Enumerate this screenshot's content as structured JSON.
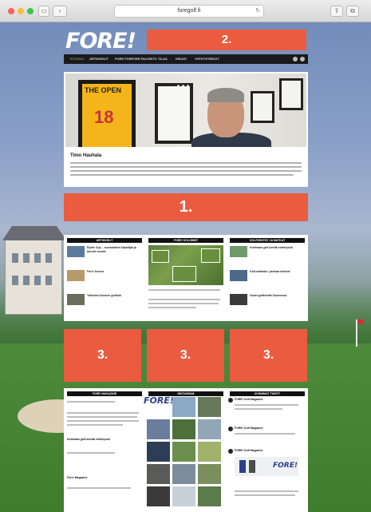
{
  "browser": {
    "address": "foregolf.fi"
  },
  "site": {
    "logo": "FORE!",
    "nav": [
      {
        "label": "ETUSIVU",
        "active": true
      },
      {
        "label": "ARTIKKELIT",
        "active": false
      },
      {
        "label": "FORE FOREVER PALKINTO",
        "active": false
      },
      {
        "label": "TILAA",
        "active": false
      },
      {
        "label": "KIRJAT",
        "active": false
      },
      {
        "label": "YHTEYSTIEDOT",
        "active": false
      }
    ]
  },
  "hero": {
    "frame_number": "18",
    "frame_text": "THE OPEN",
    "headline": "Timo Hauhala"
  },
  "callouts": {
    "top": "2.",
    "middle": "1.",
    "bottom": [
      "3.",
      "3.",
      "3."
    ]
  },
  "columns": {
    "left_header": "ARTIKKELIT",
    "center_header": "FORE! KOLUMNIT",
    "right_header": "GOLFKENTÄT JA MATKAT",
    "left_articles": [
      {
        "title": "Ryder Cup – suomalaiset kilpailijat ja tulevat vuodet"
      },
      {
        "title": "Fore! forever"
      },
      {
        "title": "Tarinoita Suomen golfista"
      }
    ],
    "right_articles": [
      {
        "title": "Kotimaan golf-kenttä esittelyssä"
      },
      {
        "title": "Golf-matkailu: parhaat kohteet"
      },
      {
        "title": "Uudet golfkentät Suomessa"
      }
    ]
  },
  "bottom": {
    "left_header": "FORE! MAGAZINE",
    "center_header": "INSTAGRAM",
    "right_header": "UUSIMMAT TWIITIT",
    "left_items": [
      {
        "title": "Kotimaan golf-kenttä esittelyssä"
      },
      {
        "title": "Fore! Magazine"
      }
    ],
    "instagram_logo": "FORE!",
    "tweets": [
      {
        "name": "FORE! Golf Magazine"
      },
      {
        "name": "FORE! Golf Magazine"
      },
      {
        "name": "FORE! Golf Magazine"
      }
    ],
    "tweet_logo": "FORE!"
  }
}
